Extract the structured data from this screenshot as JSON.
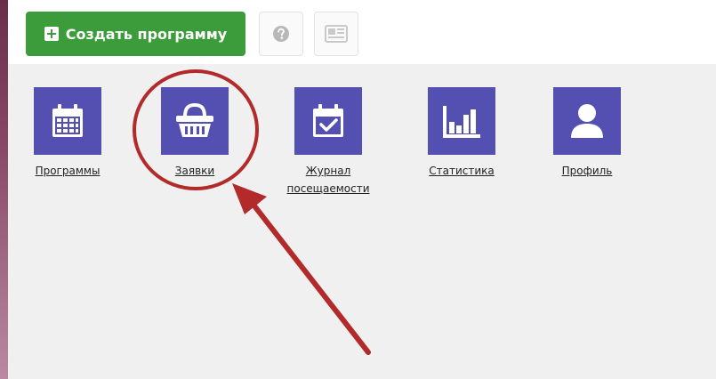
{
  "toolbar": {
    "create_label": "Создать программу",
    "create_color": "#3c9b3a"
  },
  "tiles": [
    {
      "label": "Программы",
      "icon": "calendar-icon"
    },
    {
      "label": "Заявки",
      "icon": "basket-icon"
    },
    {
      "label": "Журнал посещаемости",
      "icon": "calendar-check-icon"
    },
    {
      "label": "Статистика",
      "icon": "bar-chart-icon"
    },
    {
      "label": "Профиль",
      "icon": "user-icon"
    }
  ],
  "colors": {
    "tile": "#5450b2",
    "annotation": "#b22a2a"
  }
}
